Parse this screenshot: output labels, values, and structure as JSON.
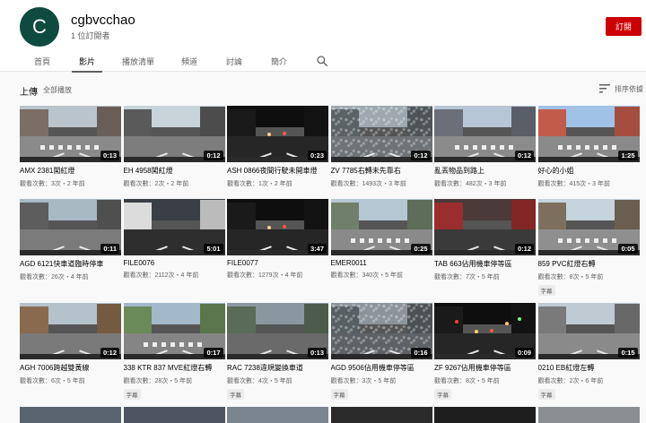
{
  "channel": {
    "avatar_letter": "C",
    "name": "cgbvcchao",
    "subscribers": "1 位訂閱者",
    "subscribe_label": "訂閱",
    "avatar_color": "#0f4a3e",
    "accent_color": "#cc0000"
  },
  "tabs": [
    {
      "label": "首頁"
    },
    {
      "label": "影片"
    },
    {
      "label": "播放清單"
    },
    {
      "label": "頻道"
    },
    {
      "label": "討論"
    },
    {
      "label": "簡介"
    }
  ],
  "active_tab": "影片",
  "search_icon": "search-icon",
  "section": {
    "title": "上傳",
    "play_all": "全部播放",
    "sort_label": "排序依據",
    "sort_icon": "sort-icon"
  },
  "videos": [
    {
      "title": "AMX 2381闖紅燈",
      "duration": "0:13",
      "meta": "觀看次數：3次・2 年前",
      "badge": ""
    },
    {
      "title": "EH 4958闖紅燈",
      "duration": "0:12",
      "meta": "觀看次數：2次・2 年前",
      "badge": ""
    },
    {
      "title": "ASH 0866夜間行駛未開車燈",
      "duration": "0:23",
      "meta": "觀看次數：1次・2 年前",
      "badge": ""
    },
    {
      "title": "ZV 7785右轉未先靠右",
      "duration": "0:12",
      "meta": "觀看次數：1493次・3 年前",
      "badge": ""
    },
    {
      "title": "亂丟物品到路上",
      "duration": "0:12",
      "meta": "觀看次數：482次・3 年前",
      "badge": ""
    },
    {
      "title": "好心的小姐",
      "duration": "1:25",
      "meta": "觀看次數：415次・3 年前",
      "badge": ""
    },
    {
      "title": "AGD 6121快車道臨時停車",
      "duration": "0:11",
      "meta": "觀看次數：26次・4 年前",
      "badge": ""
    },
    {
      "title": "FILE0076",
      "duration": "5:01",
      "meta": "觀看次數：2112次・4 年前",
      "badge": ""
    },
    {
      "title": "FILE0077",
      "duration": "3:47",
      "meta": "觀看次數：1279次・4 年前",
      "badge": ""
    },
    {
      "title": "EMER0011",
      "duration": "0:25",
      "meta": "觀看次數：340次・5 年前",
      "badge": ""
    },
    {
      "title": "TAB 663佔用機車停等區",
      "duration": "0:12",
      "meta": "觀看次數：7次・5 年前",
      "badge": ""
    },
    {
      "title": "859 PVC紅燈右轉",
      "duration": "0:05",
      "meta": "觀看次數：8次・5 年前",
      "badge": "字幕"
    },
    {
      "title": "AGH 7006跨越雙黃線",
      "duration": "0:12",
      "meta": "觀看次數：6次・5 年前",
      "badge": ""
    },
    {
      "title": "338 KTR 837 MVE紅燈右轉",
      "duration": "0:17",
      "meta": "觀看次數：28次・5 年前",
      "badge": "字幕"
    },
    {
      "title": "RAC 7238違規變換車道",
      "duration": "0:13",
      "meta": "觀看次數：4次・5 年前",
      "badge": "字幕"
    },
    {
      "title": "AGD 9506佔用機車停等區",
      "duration": "0:16",
      "meta": "觀看次數：3次・5 年前",
      "badge": "字幕"
    },
    {
      "title": "ZF 9267佔用機車停等區",
      "duration": "0:09",
      "meta": "觀看次數：8次・5 年前",
      "badge": "字幕"
    },
    {
      "title": "0210 EB紅燈左轉",
      "duration": "0:15",
      "meta": "觀看次數：2次・6 年前",
      "badge": "字幕"
    }
  ]
}
